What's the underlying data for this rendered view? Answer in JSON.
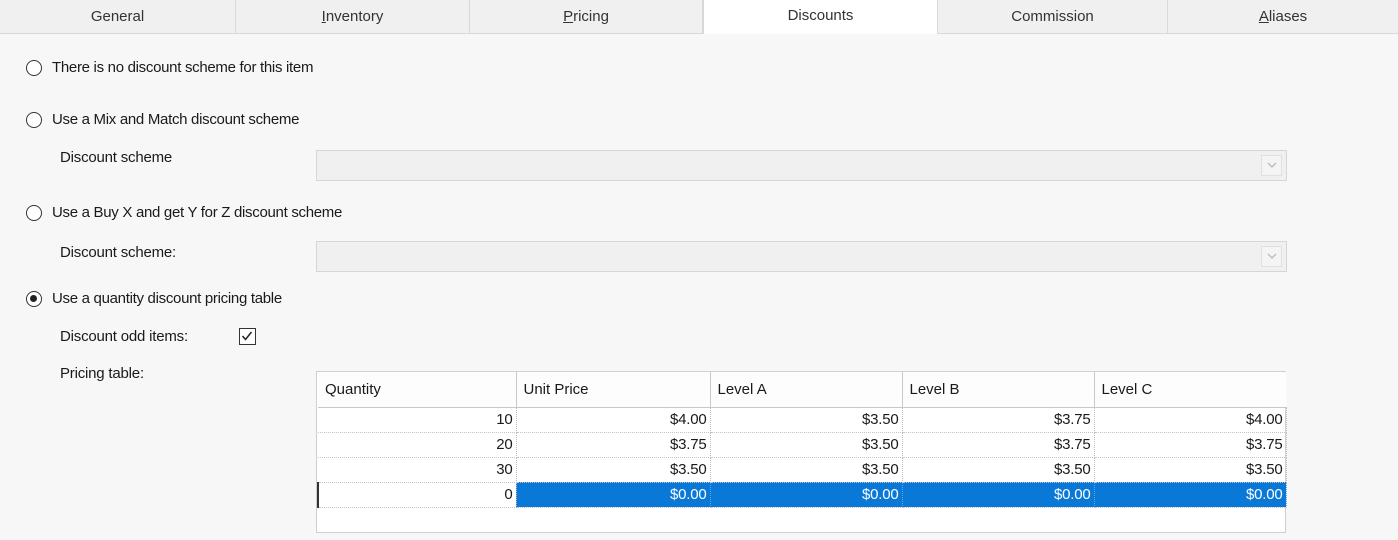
{
  "tabs": [
    {
      "label": "General",
      "mnemonic": ""
    },
    {
      "label": "nventory",
      "mnemonic": "I"
    },
    {
      "label": "ricing",
      "mnemonic": "P"
    },
    {
      "label": "Discounts",
      "mnemonic": ""
    },
    {
      "label": "Commission",
      "mnemonic": ""
    },
    {
      "label": "liases",
      "mnemonic": "A"
    }
  ],
  "active_tab": "Discounts",
  "options": {
    "no_scheme": "There is no discount scheme for this item",
    "mix_match": "Use a Mix and Match discount scheme",
    "buy_x": "Use a Buy X and get Y for Z discount scheme",
    "quantity": "Use a quantity discount pricing table"
  },
  "selected_option": "quantity",
  "labels": {
    "mix_match_scheme": "Discount scheme",
    "buy_x_scheme": "Discount scheme:",
    "odd_items": "Discount odd items:",
    "pricing_table": "Pricing table:"
  },
  "discount_odd_items_checked": true,
  "pricing_table": {
    "columns": [
      "Quantity",
      "Unit Price",
      "Level A",
      "Level B",
      "Level C"
    ],
    "rows": [
      [
        "10",
        "$4.00",
        "$3.50",
        "$3.75",
        "$4.00"
      ],
      [
        "20",
        "$3.75",
        "$3.50",
        "$3.75",
        "$3.75"
      ],
      [
        "30",
        "$3.50",
        "$3.50",
        "$3.50",
        "$3.50"
      ],
      [
        "0",
        "$0.00",
        "$0.00",
        "$0.00",
        "$0.00"
      ]
    ],
    "selected_row": 3
  },
  "colors": {
    "selection": "#0a78d6",
    "panel_bg": "#f7f7f7"
  }
}
